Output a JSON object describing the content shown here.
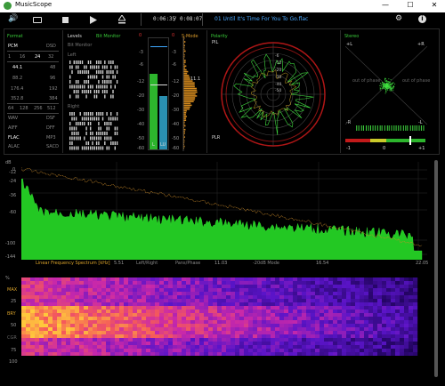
{
  "window": {
    "title": "MusicScope",
    "minimize": "—",
    "maximize": "☐",
    "close": "✕"
  },
  "toolbar": {
    "volume_icon": "speaker-icon",
    "folder_icon": "folder-icon",
    "stop_icon": "stop-icon",
    "play_icon": "play-icon",
    "eject_icon": "eject-icon",
    "elapsed": "0:06:35",
    "separator": "/",
    "duration": "0:08:07",
    "track": "01 Until It's Time For You To Go.flac",
    "settings_icon": "gear-icon",
    "info_icon": "info-icon"
  },
  "format": {
    "title": "Format",
    "pcm": "PCM",
    "dsd": "DSD",
    "bits": [
      "1",
      "16",
      "24",
      "32"
    ],
    "rates": [
      {
        "pcm": "44.1",
        "dsd": "48"
      },
      {
        "pcm": "88.2",
        "dsd": "96"
      },
      {
        "pcm": "176.4",
        "dsd": "192"
      },
      {
        "pcm": "352.8",
        "dsd": "384"
      }
    ],
    "dsd_rates": [
      "64",
      "128",
      "256",
      "512"
    ],
    "containers": [
      {
        "left": "WAV",
        "right": "DSF"
      },
      {
        "left": "AIFF",
        "right": "DFF"
      },
      {
        "left": "FLAC",
        "right": "MP3"
      },
      {
        "left": "ALAC",
        "right": "SACD"
      }
    ],
    "active": [
      "24",
      "44.1",
      "FLAC"
    ]
  },
  "levels": {
    "title": "Levels",
    "bit_monitor_header": "Bit Monitor",
    "bit_monitor": "Bit Monitor",
    "left": "Left",
    "right": "Right",
    "scale_left": [
      "0",
      "-3",
      "-6",
      "-12",
      "-20",
      "-30",
      "-40",
      "-50",
      "-60"
    ],
    "scale_right": [
      "0",
      "-3",
      "-6",
      "-12",
      "-20",
      "-30",
      "-40",
      "-50",
      "-60"
    ],
    "mode": "S-Mode",
    "peak_value": "11.1",
    "channel_l": "L",
    "channel_r": "LU",
    "level_l": 0.68,
    "level_r": 0.48
  },
  "polarity": {
    "title": "Polarity",
    "pil": "PIL",
    "plr": "PLR",
    "rings": [
      "-6",
      "-12",
      "-20",
      "-30",
      "-40",
      "-50"
    ]
  },
  "stereo": {
    "title": "Stereo",
    "plus_l": "+L",
    "plus_r": "+R",
    "minus_l": "-L",
    "minus_r": "-R",
    "out_of_phase_left": "out of phase",
    "out_of_phase_right": "out of phase",
    "corr_min": "-1",
    "corr_mid": "0",
    "corr_max": "+1",
    "correlation": 0.6
  },
  "spectrum": {
    "db_label": "dB",
    "y_ticks": [
      "0",
      "-12",
      "-24",
      "-36",
      "-60",
      "-100",
      "-144"
    ],
    "caption": "Linear Frequency Spectrum [kHz]",
    "x_ticks": [
      "5.51",
      "11.03",
      "16.54",
      "22.05"
    ],
    "mode_left_right": "Left/Right",
    "mode_pans": "Pans/Phase",
    "mode_20db": "-20dB Mode"
  },
  "spectrogram": {
    "percent_label": "%",
    "y_ticks": [
      "MAX",
      "25",
      "BRY",
      "50",
      "CGR",
      "75",
      "100"
    ]
  }
}
